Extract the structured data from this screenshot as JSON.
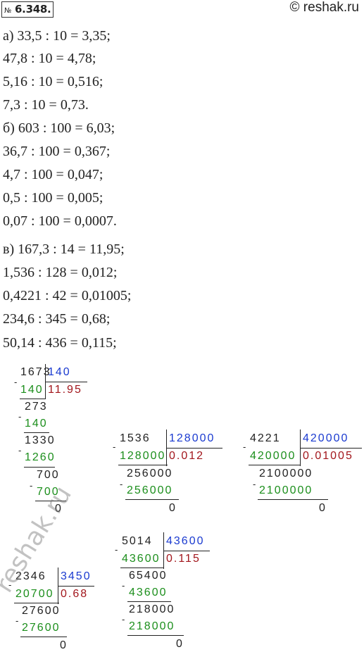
{
  "header": {
    "badge_prefix": "№",
    "badge_number": "6.348.",
    "site": "© reshak.ru"
  },
  "lines": [
    "а) 33,5 : 10 = 3,35;",
    "47,8 : 10 = 4,78;",
    "5,16 : 10 = 0,516;",
    "7,3 : 10 = 0,73.",
    "б) 603 : 100 = 6,03;",
    "36,7 : 100 = 0,367;",
    "4,7 : 100 = 0,047;",
    "0,5 : 100 = 0,005;",
    "0,07 : 100 = 0,0007.",
    "в) 167,3 : 14 = 11,95;",
    "1,536 : 128 = 0,012;",
    "0,4221 : 42 = 0,01005;",
    "234,6 : 345 = 0,68;",
    "50,14 : 436 = 0,115;"
  ],
  "divisions": {
    "d1": {
      "dividend": "1673",
      "divisor": "140",
      "quotient": "11.95",
      "steps": [
        "140",
        "273",
        "140",
        "1330",
        "1260",
        "700",
        "700",
        "0"
      ]
    },
    "d2": {
      "dividend": "1536",
      "divisor": "128000",
      "quotient": "0.012",
      "steps": [
        "128000",
        "256000",
        "256000",
        "0"
      ]
    },
    "d3": {
      "dividend": "4221",
      "divisor": "420000",
      "quotient": "0.01005",
      "steps": [
        "420000",
        "2100000",
        "2100000",
        "0"
      ]
    },
    "d4": {
      "dividend": "2346",
      "divisor": "3450",
      "quotient": "0.68",
      "steps": [
        "20700",
        "27600",
        "27600",
        "0"
      ]
    },
    "d5": {
      "dividend": "5014",
      "divisor": "43600",
      "quotient": "0.115",
      "steps": [
        "43600",
        "65400",
        "43600",
        "218000",
        "218000",
        "0"
      ]
    }
  },
  "watermark": "reshak.ru"
}
